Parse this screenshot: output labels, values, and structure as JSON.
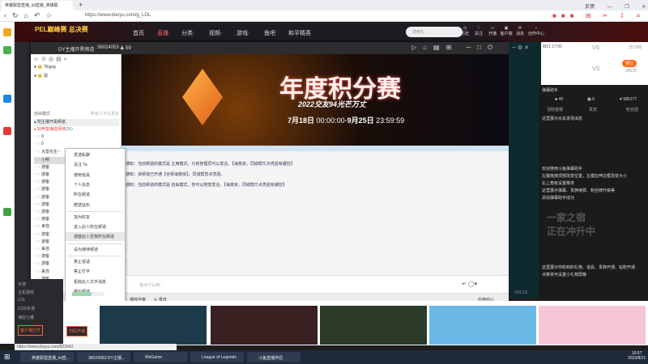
{
  "browser": {
    "tab_title": "英雄联盟直播_lol直播_英雄联",
    "new_tab": "+",
    "url": "https://www.douyu.com/g_LOL",
    "win_controls": [
      "反馈",
      "—",
      "❐",
      "✕"
    ]
  },
  "nav": {
    "items": [
      "首页",
      "直播",
      "分类·",
      "视频·",
      "游戏·",
      "鱼吧",
      "和平精英"
    ],
    "banner": "PEL巅峰赛 总决赛",
    "search_placeholder": "搜索礼",
    "tools": [
      "历史",
      "关注",
      "开播",
      "客户端",
      "消息",
      "创作中心"
    ],
    "badges": [
      "9",
      "58"
    ]
  },
  "app": {
    "channel": "DY主播开黑频道",
    "room_id": "36024053",
    "online": "59",
    "users": [
      {
        "name": "TEgog"
      },
      {
        "name": "鼠"
      }
    ],
    "mode_label": "自由模式",
    "mode_hint": "所有人可以发言",
    "channels": [
      {
        "name": "附主播开黑频道"
      },
      {
        "name": "好声音海选场地",
        "count": "(56)"
      }
    ],
    "members": [
      "0",
      "0",
      "大雷先生~",
      "小明",
      "游客",
      "游客",
      "游客",
      "游客",
      "游客",
      "游客",
      "游客",
      "游客",
      "来自",
      "游客",
      "游客",
      "来自",
      "游客",
      "游客",
      "来自",
      "游客",
      "游客",
      "来自"
    ],
    "banner": {
      "title": "年度积分赛",
      "subtitle": "2022交友94光芒万丈",
      "date_start": "7月18日",
      "time_start": "00:00:00-",
      "date_end": "9月25日",
      "time_end": "23:59:59"
    },
    "messages": [
      "通知：当前频道的模式是 主席模式，只有管理员可以发言。【海景房，同城帮忙点亮验有缓控】",
      "通知：该频道已开通【全频海景房】，同城帮您点亮验。",
      "通知：当前频道的模式是 自由模式，你可以随意发言。【海景房，同城帮忙点亮验有缓控】"
    ],
    "input_placeholder": "说点什么吧...",
    "bottom": [
      "播放伴奏",
      "录音"
    ],
    "app_center": "应用中心"
  },
  "context_menu": [
    "发送私聊",
    "关注 Ta",
    "使用道具",
    "个人信息",
    "所在频道",
    "赠送钻石",
    "加为好友",
    "进入此人所在频道",
    "调度此人至我所在频道",
    "设为接待频道",
    "禁止说话",
    "禁止打字",
    "拒收此人文字消息",
    "踢出频道"
  ],
  "sidebar_left": {
    "items": [
      "手游",
      "主机游戏",
      "LOL",
      "COD手游",
      "海狂七雄"
    ],
    "btn_client": "客户端打开",
    "btn_live": "扫码开播"
  },
  "schedule": {
    "time": "8/21 17:00",
    "vs": "VS",
    "book": "预订",
    "counts": [
      "257985",
      "28525"
    ]
  },
  "danmu": {
    "title": "弹幕助手",
    "stats": [
      "40",
      "0",
      "585177"
    ],
    "tabs": [
      "活跃度榜",
      "贵宾",
      "粉丝团"
    ],
    "line1": "这里展示水友进场消息",
    "help": [
      "欢迎使用斗鱼弹幕助手",
      "左键拖拽顶部改变位置，左键拉伸边框改变大小",
      "右上角有设置菜单",
      "这里展示弹幕、贵族续费、粉丝牌升级等",
      "添加弹幕助手成功"
    ],
    "gift_info": [
      "这里展示你收到的礼物、道具、贵族开通、钻粉开通",
      "点菜单可设置小礼物屏蔽"
    ],
    "ad": "一家之宿 正在冲升中",
    "version": "V15.13"
  },
  "status_url": "https://www.douyu.com/823042",
  "taskbar": {
    "items": [
      "英雄联盟直播_lol直...",
      "36024053-DY主播...",
      "WeGame",
      "League of Legends",
      "斗鱼直播伴侣"
    ],
    "time": "16:57",
    "date": "2022/8/21"
  }
}
